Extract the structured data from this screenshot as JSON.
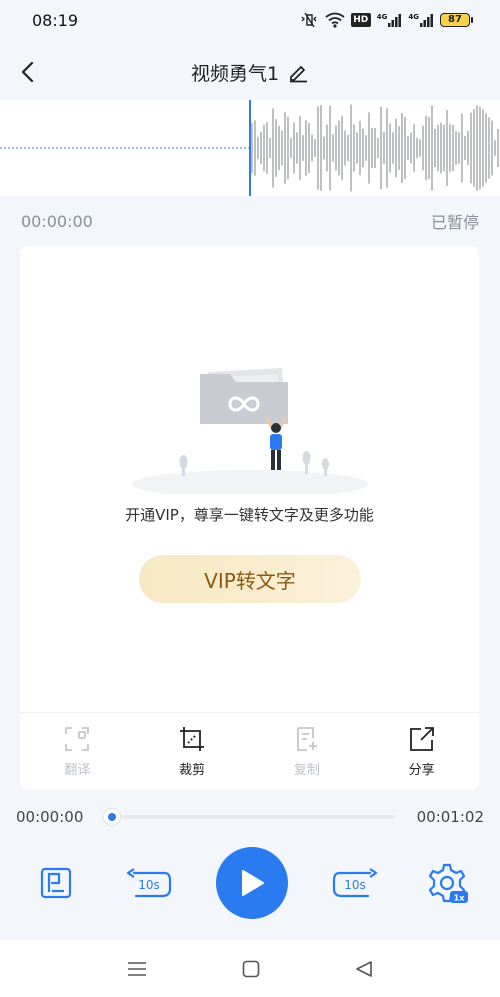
{
  "status_bar": {
    "time": "08:19",
    "battery": "87",
    "hd_label": "HD",
    "net_label_1": "4G",
    "net_label_2": "4G"
  },
  "header": {
    "title": "视频勇气1"
  },
  "playback": {
    "current_time": "00:00:00",
    "state": "已暂停"
  },
  "card": {
    "promo_text": "开通VIP，尊享一键转文字及更多功能",
    "vip_button_label": "VIP转文字",
    "tools": [
      {
        "label": "翻译",
        "icon": "scan-icon",
        "enabled": false
      },
      {
        "label": "裁剪",
        "icon": "crop-icon",
        "enabled": true
      },
      {
        "label": "复制",
        "icon": "copy-doc-icon",
        "enabled": false
      },
      {
        "label": "分享",
        "icon": "share-icon",
        "enabled": true
      }
    ]
  },
  "progress": {
    "current": "00:00:00",
    "total": "00:01:02",
    "fraction": 0
  },
  "controls": {
    "rewind_label": "10s",
    "forward_label": "10s",
    "speed_label": "1x"
  },
  "colors": {
    "accent": "#2a7bf0",
    "vip_text": "#8a5a14",
    "background": "#f3f6fb"
  }
}
